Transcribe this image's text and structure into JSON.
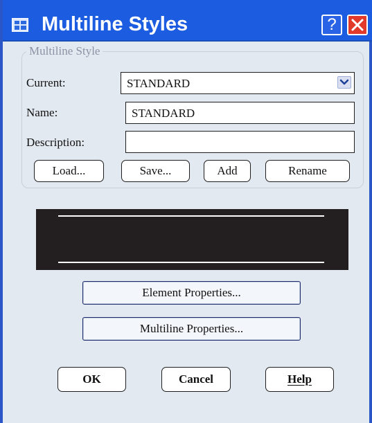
{
  "window": {
    "title": "Multiline Styles",
    "help_label": "?"
  },
  "multiline_style": {
    "group_label": "Multiline Style",
    "current_label": "Current:",
    "current_value": "STANDARD",
    "name_label": "Name:",
    "name_value": "STANDARD",
    "description_label": "Description:",
    "description_value": "",
    "buttons": {
      "load": "Load...",
      "save": "Save...",
      "add": "Add",
      "rename": "Rename"
    }
  },
  "properties": {
    "element": "Element Properties...",
    "multiline": "Multiline Properties..."
  },
  "footer": {
    "ok": "OK",
    "cancel": "Cancel",
    "help": "Help"
  },
  "colors": {
    "titlebar": "#1c5ce0",
    "dialog_bg": "#e3e9f1",
    "close_button": "#e23a2a",
    "preview_bg": "#231f20"
  },
  "icons": [
    "dialog-app-icon",
    "help-icon",
    "close-icon",
    "chevron-down-icon"
  ]
}
